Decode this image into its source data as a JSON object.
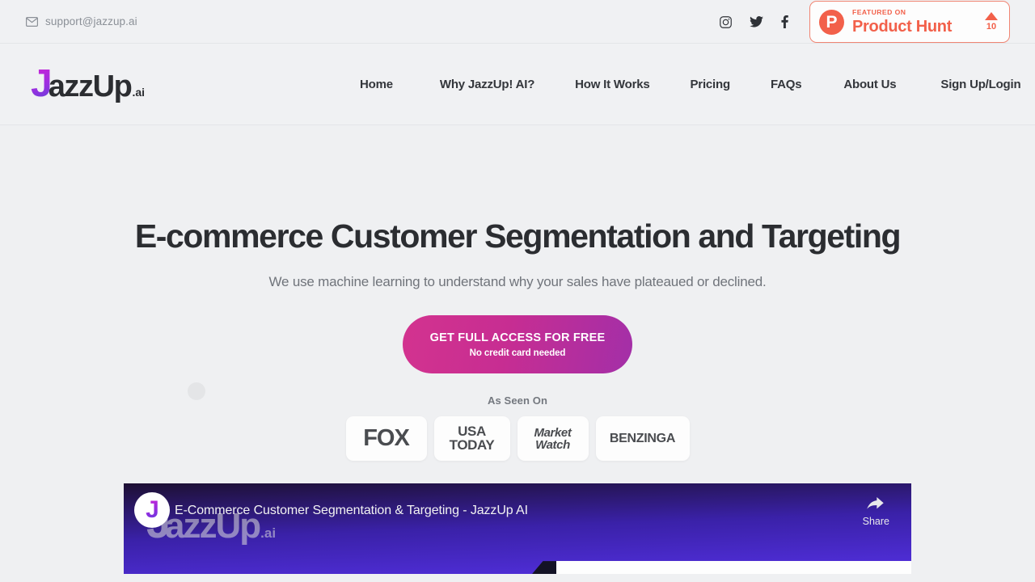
{
  "topbar": {
    "email": "support@jazzup.ai",
    "mail_icon": "mail-icon",
    "social": [
      {
        "name": "instagram-icon",
        "label": "Instagram"
      },
      {
        "name": "twitter-icon",
        "label": "Twitter"
      },
      {
        "name": "facebook-icon",
        "label": "Facebook"
      }
    ],
    "product_hunt": {
      "logo_letter": "P",
      "featured_on": "FEATURED ON",
      "name": "Product Hunt",
      "upvotes": "10",
      "accent_color": "#f2604a"
    }
  },
  "header": {
    "logo": {
      "first": "J",
      "rest": "azzUp",
      "suffix": ".ai"
    },
    "nav": [
      {
        "label": "Home"
      },
      {
        "label": "Why JazzUp! AI?"
      },
      {
        "label": "How It Works"
      },
      {
        "label": "Pricing"
      },
      {
        "label": "FAQs"
      },
      {
        "label": "About Us"
      },
      {
        "label": "Sign Up/Login"
      }
    ]
  },
  "hero": {
    "title": "E-commerce Customer Segmentation and Targeting",
    "subtitle": "We use machine learning to understand why your sales have plateaued or declined.",
    "cta": {
      "label": "GET FULL ACCESS FOR FREE",
      "sublabel": "No credit card needed",
      "gradient_from": "#d3338f",
      "gradient_to": "#a32fa8"
    }
  },
  "press": {
    "label": "As Seen On",
    "items": [
      {
        "name": "fox",
        "line1": "FOX",
        "line2": ""
      },
      {
        "name": "usa-today",
        "line1": "USA",
        "line2": "TODAY"
      },
      {
        "name": "market-watch",
        "line1": "Market",
        "line2": "Watch"
      },
      {
        "name": "benzinga",
        "line1": "BENZINGA",
        "line2": ""
      }
    ]
  },
  "video": {
    "avatar_letter": "J",
    "title": "E-Commerce Customer Segmentation & Targeting - JazzUp AI",
    "share_label": "Share",
    "share_icon": "share-arrow-icon",
    "watermark": {
      "first": "J",
      "rest": "azzUp",
      "suffix": ".ai"
    }
  }
}
